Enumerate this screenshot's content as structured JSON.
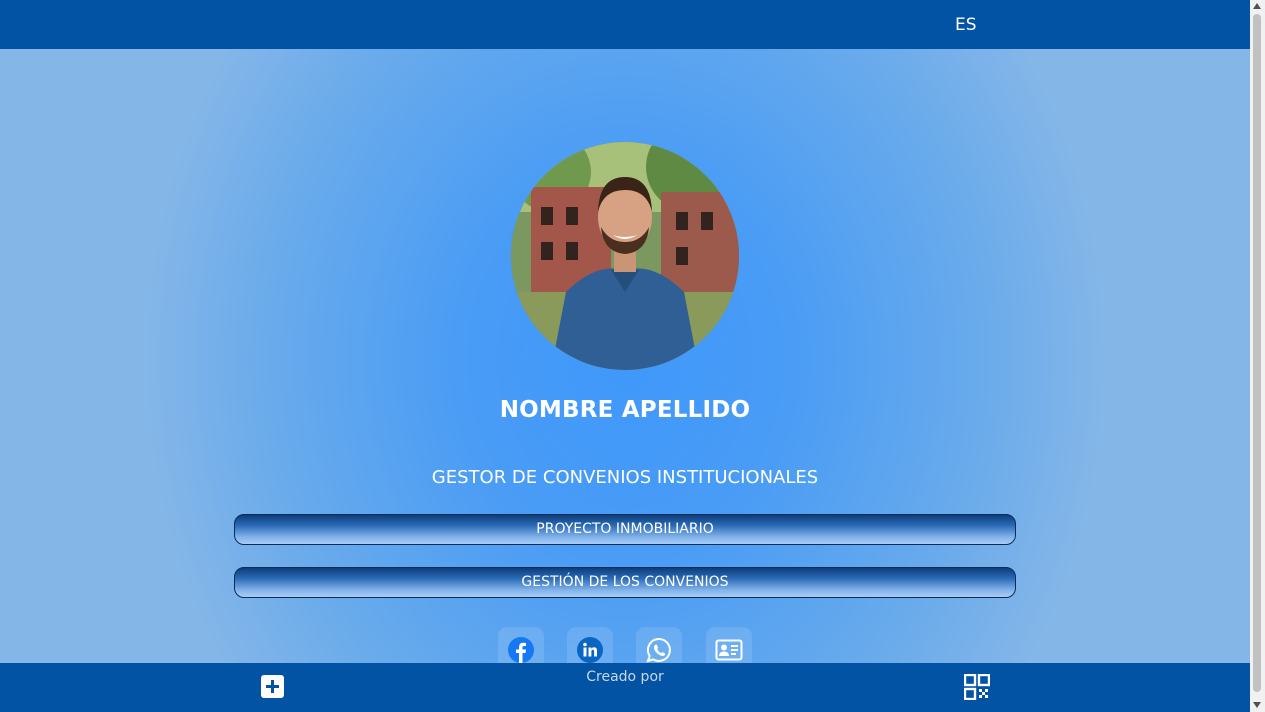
{
  "header": {
    "language": "ES"
  },
  "profile": {
    "name": "NOMBRE APELLIDO",
    "role": "GESTOR DE CONVENIOS INSTITUCIONALES"
  },
  "links": [
    {
      "label": "PROYECTO INMOBILIARIO"
    },
    {
      "label": "GESTIÓN DE LOS CONVENIOS"
    }
  ],
  "social": [
    {
      "icon": "facebook-icon",
      "color": "#1877f2"
    },
    {
      "icon": "linkedin-icon",
      "color": "#0a66c2"
    },
    {
      "icon": "whatsapp-icon",
      "color": "#ffffff"
    },
    {
      "icon": "contact-card-icon",
      "color": "#ffffff"
    }
  ],
  "footer": {
    "created_by": "Creado por",
    "add_icon": "plus-icon",
    "qr_icon": "qr-code-icon"
  },
  "colors": {
    "bar": "#0353a4",
    "background": "#3f98fb"
  }
}
